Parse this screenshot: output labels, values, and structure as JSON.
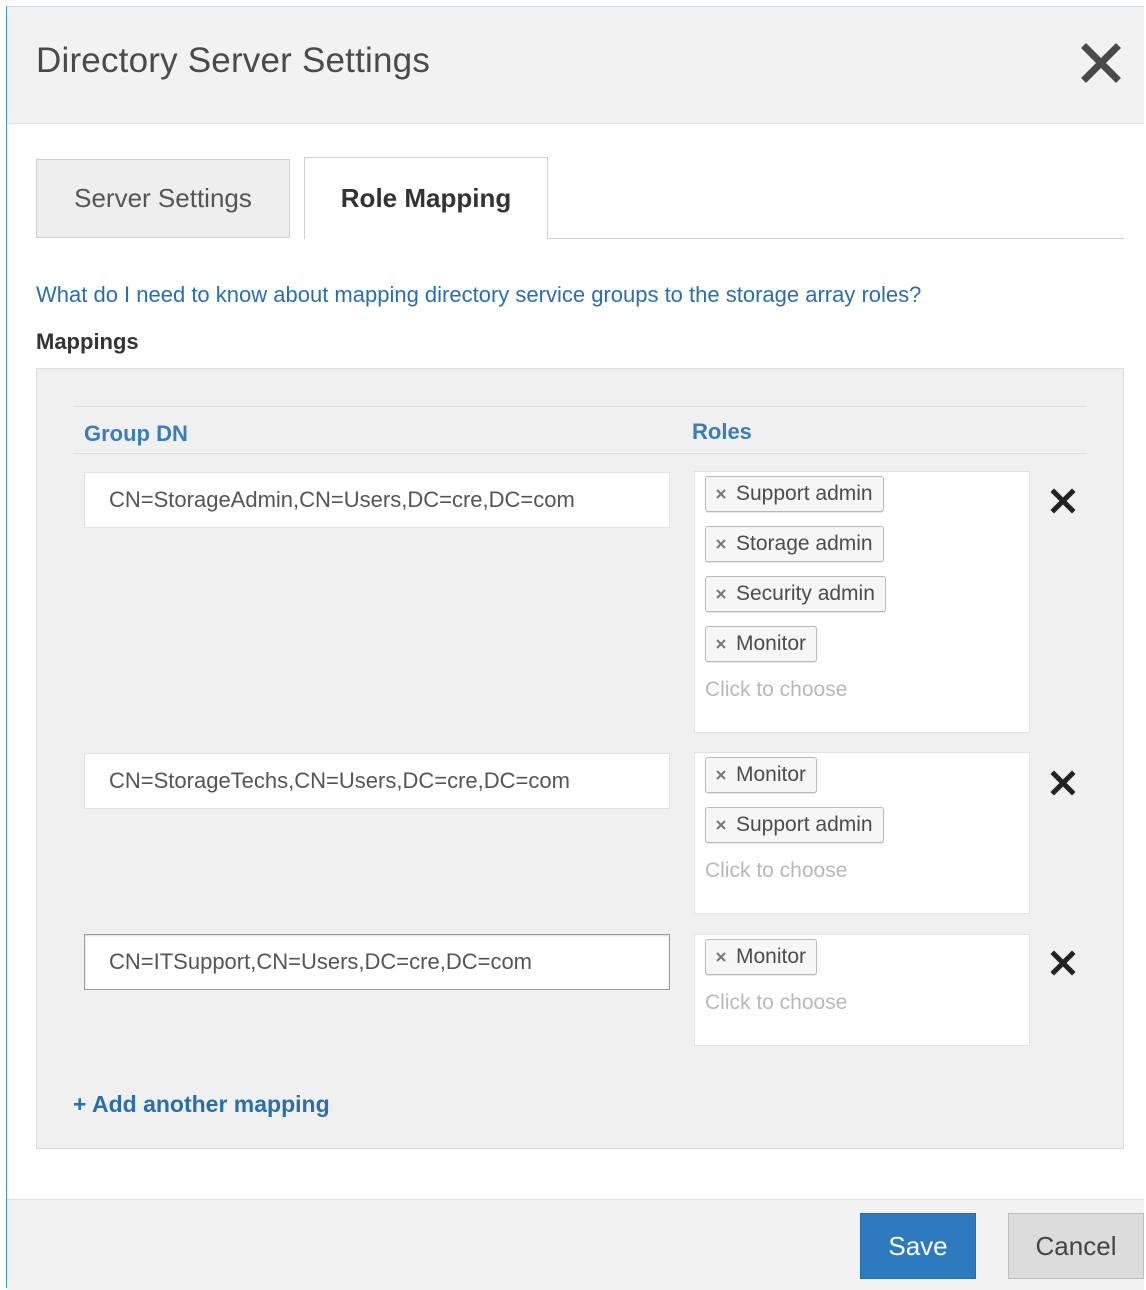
{
  "dialog": {
    "title": "Directory Server Settings"
  },
  "tabs": [
    {
      "label": "Server Settings"
    },
    {
      "label": "Role Mapping"
    }
  ],
  "help_link": "What do I need to know about mapping directory service groups to the storage array roles?",
  "section_title": "Mappings",
  "columns": {
    "group_dn": "Group DN",
    "roles": "Roles"
  },
  "mappings": [
    {
      "group_dn": "CN=StorageAdmin,CN=Users,DC=cre,DC=com",
      "roles": [
        "Support admin",
        "Storage admin",
        "Security admin",
        "Monitor"
      ],
      "placeholder": "Click to choose"
    },
    {
      "group_dn": "CN=StorageTechs,CN=Users,DC=cre,DC=com",
      "roles": [
        "Monitor",
        "Support admin"
      ],
      "placeholder": "Click to choose"
    },
    {
      "group_dn": "CN=ITSupport,CN=Users,DC=cre,DC=com",
      "roles": [
        "Monitor"
      ],
      "placeholder": "Click to choose"
    }
  ],
  "add_mapping": "+ Add another mapping",
  "footer": {
    "save_label": "Save",
    "cancel_label": "Cancel"
  },
  "colors": {
    "accent": "#2e7abf",
    "link": "#2a6fad"
  }
}
